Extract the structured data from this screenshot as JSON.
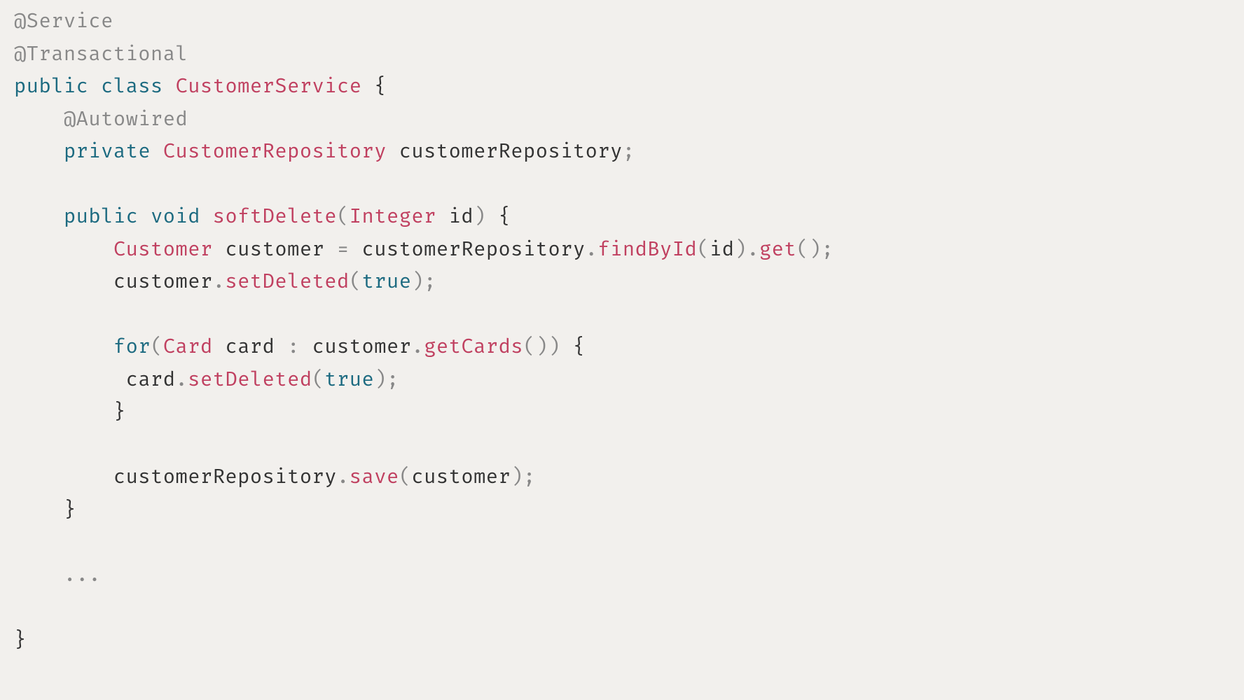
{
  "code": {
    "lines": [
      {
        "indent": 0,
        "tokens": [
          {
            "cls": "tok-annot",
            "t": "@Service"
          }
        ]
      },
      {
        "indent": 0,
        "tokens": [
          {
            "cls": "tok-annot",
            "t": "@Transactional"
          }
        ]
      },
      {
        "indent": 0,
        "tokens": [
          {
            "cls": "tok-kw",
            "t": "public"
          },
          {
            "cls": null,
            "t": " "
          },
          {
            "cls": "tok-kw",
            "t": "class"
          },
          {
            "cls": null,
            "t": " "
          },
          {
            "cls": "tok-type",
            "t": "CustomerService"
          },
          {
            "cls": null,
            "t": " "
          },
          {
            "cls": "tok-plain",
            "t": "{"
          }
        ]
      },
      {
        "indent": 1,
        "tokens": [
          {
            "cls": "tok-annot",
            "t": "@Autowired"
          }
        ]
      },
      {
        "indent": 1,
        "tokens": [
          {
            "cls": "tok-kw",
            "t": "private"
          },
          {
            "cls": null,
            "t": " "
          },
          {
            "cls": "tok-type",
            "t": "CustomerRepository"
          },
          {
            "cls": null,
            "t": " "
          },
          {
            "cls": "tok-plain",
            "t": "customerRepository"
          },
          {
            "cls": "tok-punc",
            "t": ";"
          }
        ]
      },
      {
        "indent": 0,
        "tokens": []
      },
      {
        "indent": 1,
        "tokens": [
          {
            "cls": "tok-kw",
            "t": "public"
          },
          {
            "cls": null,
            "t": " "
          },
          {
            "cls": "tok-kw",
            "t": "void"
          },
          {
            "cls": null,
            "t": " "
          },
          {
            "cls": "tok-meth",
            "t": "softDelete"
          },
          {
            "cls": "tok-punc",
            "t": "("
          },
          {
            "cls": "tok-type",
            "t": "Integer"
          },
          {
            "cls": null,
            "t": " "
          },
          {
            "cls": "tok-plain",
            "t": "id"
          },
          {
            "cls": "tok-punc",
            "t": ")"
          },
          {
            "cls": null,
            "t": " "
          },
          {
            "cls": "tok-plain",
            "t": "{"
          }
        ]
      },
      {
        "indent": 2,
        "tokens": [
          {
            "cls": "tok-type",
            "t": "Customer"
          },
          {
            "cls": null,
            "t": " "
          },
          {
            "cls": "tok-plain",
            "t": "customer"
          },
          {
            "cls": null,
            "t": " "
          },
          {
            "cls": "tok-op",
            "t": "="
          },
          {
            "cls": null,
            "t": " "
          },
          {
            "cls": "tok-plain",
            "t": "customerRepository"
          },
          {
            "cls": "tok-punc",
            "t": "."
          },
          {
            "cls": "tok-meth",
            "t": "findById"
          },
          {
            "cls": "tok-punc",
            "t": "("
          },
          {
            "cls": "tok-plain",
            "t": "id"
          },
          {
            "cls": "tok-punc",
            "t": ")"
          },
          {
            "cls": "tok-punc",
            "t": "."
          },
          {
            "cls": "tok-meth",
            "t": "get"
          },
          {
            "cls": "tok-punc",
            "t": "()"
          },
          {
            "cls": "tok-punc",
            "t": ";"
          }
        ]
      },
      {
        "indent": 2,
        "tokens": [
          {
            "cls": "tok-plain",
            "t": "customer"
          },
          {
            "cls": "tok-punc",
            "t": "."
          },
          {
            "cls": "tok-meth",
            "t": "setDeleted"
          },
          {
            "cls": "tok-punc",
            "t": "("
          },
          {
            "cls": "tok-lit",
            "t": "true"
          },
          {
            "cls": "tok-punc",
            "t": ")"
          },
          {
            "cls": "tok-punc",
            "t": ";"
          }
        ]
      },
      {
        "indent": 0,
        "tokens": []
      },
      {
        "indent": 2,
        "tokens": [
          {
            "cls": "tok-kw",
            "t": "for"
          },
          {
            "cls": "tok-punc",
            "t": "("
          },
          {
            "cls": "tok-type",
            "t": "Card"
          },
          {
            "cls": null,
            "t": " "
          },
          {
            "cls": "tok-plain",
            "t": "card"
          },
          {
            "cls": null,
            "t": " "
          },
          {
            "cls": "tok-punc",
            "t": ":"
          },
          {
            "cls": null,
            "t": " "
          },
          {
            "cls": "tok-plain",
            "t": "customer"
          },
          {
            "cls": "tok-punc",
            "t": "."
          },
          {
            "cls": "tok-meth",
            "t": "getCards"
          },
          {
            "cls": "tok-punc",
            "t": "()"
          },
          {
            "cls": "tok-punc",
            "t": ")"
          },
          {
            "cls": null,
            "t": " "
          },
          {
            "cls": "tok-plain",
            "t": "{"
          }
        ]
      },
      {
        "indent": 2,
        "tokens": [
          {
            "cls": null,
            "t": " "
          },
          {
            "cls": "tok-plain",
            "t": "card"
          },
          {
            "cls": "tok-punc",
            "t": "."
          },
          {
            "cls": "tok-meth",
            "t": "setDeleted"
          },
          {
            "cls": "tok-punc",
            "t": "("
          },
          {
            "cls": "tok-lit",
            "t": "true"
          },
          {
            "cls": "tok-punc",
            "t": ")"
          },
          {
            "cls": "tok-punc",
            "t": ";"
          }
        ]
      },
      {
        "indent": 2,
        "tokens": [
          {
            "cls": "tok-plain",
            "t": "}"
          }
        ]
      },
      {
        "indent": 0,
        "tokens": []
      },
      {
        "indent": 2,
        "tokens": [
          {
            "cls": "tok-plain",
            "t": "customerRepository"
          },
          {
            "cls": "tok-punc",
            "t": "."
          },
          {
            "cls": "tok-meth",
            "t": "save"
          },
          {
            "cls": "tok-punc",
            "t": "("
          },
          {
            "cls": "tok-plain",
            "t": "customer"
          },
          {
            "cls": "tok-punc",
            "t": ")"
          },
          {
            "cls": "tok-punc",
            "t": ";"
          }
        ]
      },
      {
        "indent": 1,
        "tokens": [
          {
            "cls": "tok-plain",
            "t": "}"
          }
        ]
      },
      {
        "indent": 0,
        "tokens": []
      },
      {
        "indent": 1,
        "tokens": [
          {
            "cls": "ellipsis",
            "t": "..."
          }
        ]
      },
      {
        "indent": 0,
        "tokens": []
      },
      {
        "indent": 0,
        "tokens": [
          {
            "cls": "tok-plain",
            "t": "}"
          }
        ]
      }
    ],
    "indent_unit": "    "
  }
}
